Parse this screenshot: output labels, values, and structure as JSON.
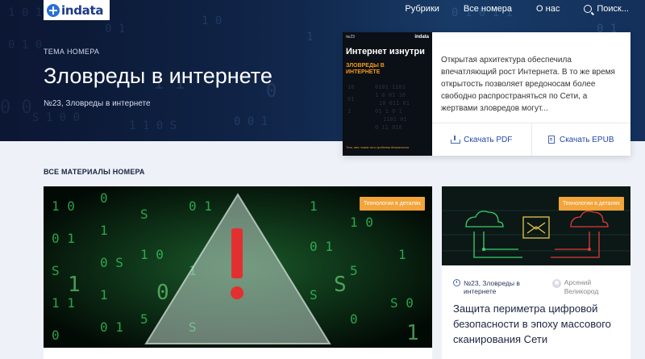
{
  "header": {
    "logo_text": "indata",
    "logo_tagline": "",
    "nav": [
      "Рубрики",
      "Все номера",
      "О нас"
    ],
    "search_label": "Поиск..."
  },
  "hero": {
    "label": "ТЕМА НОМЕРА",
    "title": "Зловреды в интернете",
    "subtitle": "№23, Зловреды в интернете"
  },
  "issue_card": {
    "cover": {
      "number": "№23",
      "logo": "indata",
      "title": "Интернет изнутри",
      "subtitle": "ЗЛОВРЕДЫ В ИНТЕРНЕТЕ",
      "footer": "Тени, свет, новые сети; проблемы безопасности"
    },
    "description": "Открытая архитектура обеспечила впечатляющий рост Интернета. В то же время открытость позволяет вредоносам более свободно распространяться по Сети, а жертвами зловредов могут...",
    "download_pdf": "Скачать PDF",
    "download_epub": "Скачать EPUB"
  },
  "section": {
    "title": "ВСЕ МАТЕРИАЛЫ НОМЕРА"
  },
  "articles": [
    {
      "badge": "Технологии в деталях"
    },
    {
      "badge": "Технологии в деталях",
      "issue": "№23, Зловреды в интернете",
      "author": "Арсений Великород",
      "title": "Защита периметра цифровой безопасности в эпоху массового сканирования Сети"
    }
  ],
  "colors": {
    "accent": "#2349a8",
    "badge": "#f3a43a",
    "background": "#eef1f8"
  }
}
